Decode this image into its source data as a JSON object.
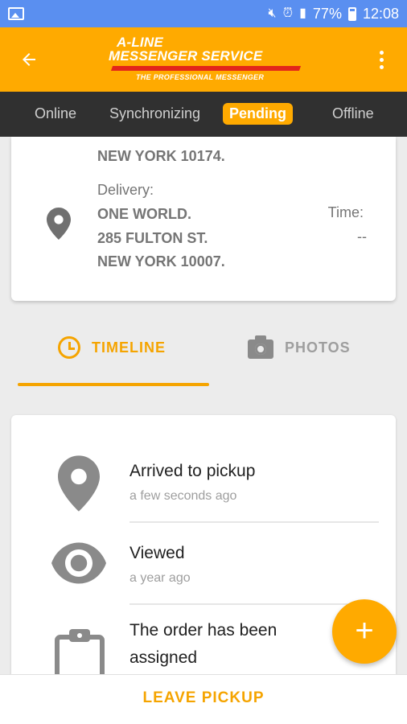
{
  "status_bar": {
    "battery": "77%",
    "time": "12:08",
    "icons": [
      "gallery-icon",
      "mute-icon",
      "alarm-icon",
      "signal-icon",
      "battery-icon"
    ]
  },
  "app_bar": {
    "logo_line1": "A-LINE",
    "logo_line2": "MESSENGER SERVICE",
    "logo_tagline": "THE PROFESSIONAL MESSENGER",
    "background": "#ffaa00"
  },
  "sync_tabs": [
    {
      "label": "Online",
      "active": false
    },
    {
      "label": "Synchronizing",
      "active": false
    },
    {
      "label": "Pending",
      "active": true
    },
    {
      "label": "Offline",
      "active": false
    }
  ],
  "address_card": {
    "pickup_tail": "NEW YORK 10174.",
    "delivery_label": "Delivery:",
    "delivery_line1": "ONE WORLD.",
    "delivery_line2": "285 FULTON ST.",
    "delivery_line3": "NEW YORK 10007.",
    "time_label": "Time:",
    "time_value": "--"
  },
  "tabs": {
    "timeline": "TIMELINE",
    "photos": "PHOTOS",
    "active": "timeline"
  },
  "timeline": [
    {
      "title": "Arrived to pickup",
      "subtitle": "a few seconds ago",
      "icon": "location-pin-icon"
    },
    {
      "title": "Viewed",
      "subtitle": "a year ago",
      "icon": "eye-icon"
    },
    {
      "title_line1": "The order has been",
      "title_line2": "assigned",
      "icon": "clipboard-icon"
    }
  ],
  "fab": {
    "label": "+"
  },
  "bottom_button": {
    "label": "LEAVE PICKUP"
  },
  "colors": {
    "accent": "#ffaa00",
    "dark_bar": "#303030",
    "status_bar": "#5a8ff0"
  }
}
